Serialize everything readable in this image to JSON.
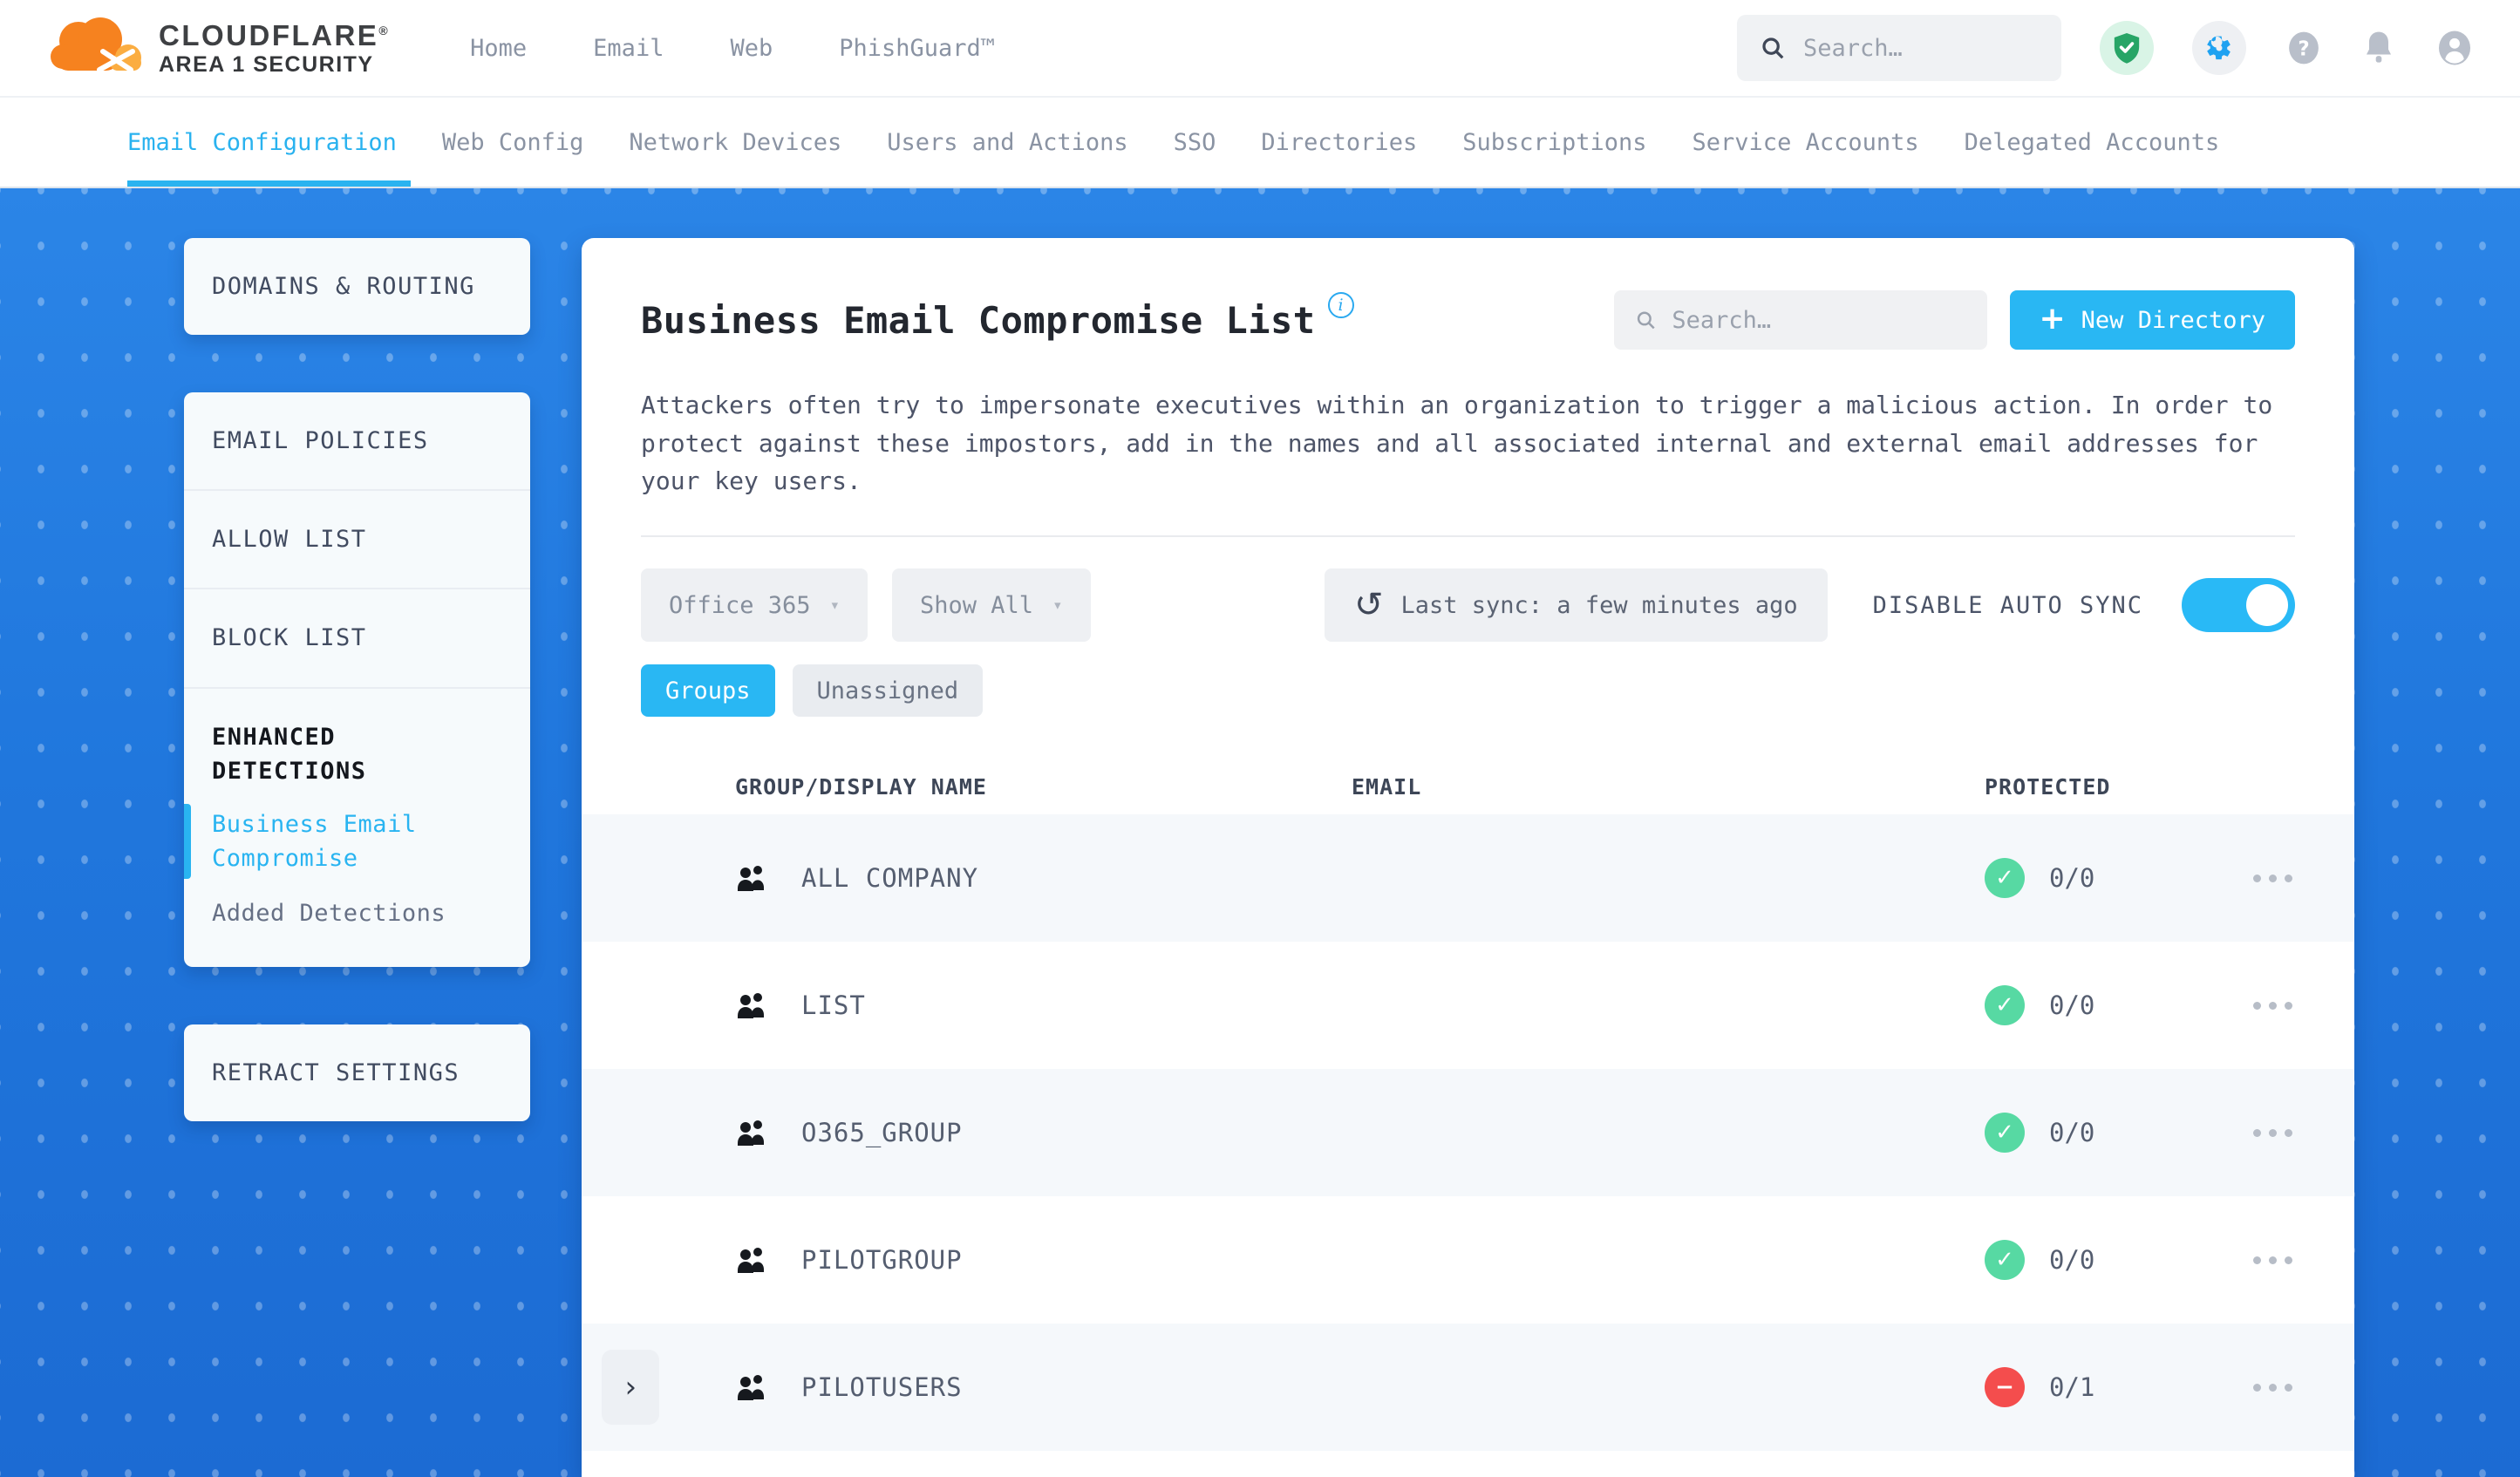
{
  "header": {
    "brand_line1": "CLOUDFLARE",
    "brand_reg": "®",
    "brand_line2": "AREA 1 SECURITY",
    "nav": [
      "Home",
      "Email",
      "Web",
      "PhishGuard™"
    ],
    "search_placeholder": "Search…"
  },
  "subnav": {
    "items": [
      {
        "label": "Email Configuration",
        "active": true
      },
      {
        "label": "Web Config",
        "active": false
      },
      {
        "label": "Network Devices",
        "active": false
      },
      {
        "label": "Users and Actions",
        "active": false
      },
      {
        "label": "SSO",
        "active": false
      },
      {
        "label": "Directories",
        "active": false
      },
      {
        "label": "Subscriptions",
        "active": false
      },
      {
        "label": "Service Accounts",
        "active": false
      },
      {
        "label": "Delegated Accounts",
        "active": false
      }
    ]
  },
  "sidebar": {
    "cards": [
      {
        "items": [
          {
            "label": "DOMAINS & ROUTING"
          }
        ]
      },
      {
        "items": [
          {
            "label": "EMAIL POLICIES",
            "divider": true
          },
          {
            "label": "ALLOW LIST",
            "divider": true
          },
          {
            "label": "BLOCK LIST",
            "divider": true
          },
          {
            "label": "ENHANCED DETECTIONS",
            "emphasis": true
          },
          {
            "label": "Business Email Compromise",
            "sub": true,
            "active": true
          },
          {
            "label": "Added Detections",
            "sub": true,
            "muted": true,
            "last": true
          }
        ]
      },
      {
        "items": [
          {
            "label": "RETRACT SETTINGS"
          }
        ]
      }
    ]
  },
  "main": {
    "title": "Business Email Compromise List",
    "info_glyph": "i",
    "search_placeholder": "Search…",
    "new_directory_plus": "+",
    "new_directory_label": "New Directory",
    "description": "Attackers often try to impersonate executives within an organization to trigger a malicious action. In order to protect against these impostors, add in the names and all associated internal and external email addresses for your key users.",
    "filters": {
      "directory": "Office 365",
      "show": "Show All",
      "caret": "▾"
    },
    "sync": {
      "refresh_glyph": "↺",
      "last_sync_label": "Last sync: a few minutes ago",
      "auto_sync_label": "DISABLE AUTO SYNC",
      "toggle_on": true
    },
    "tabs": [
      {
        "label": "Groups",
        "active": true
      },
      {
        "label": "Unassigned",
        "active": false
      }
    ],
    "table": {
      "columns": [
        "GROUP/DISPLAY NAME",
        "EMAIL",
        "PROTECTED"
      ],
      "rows": [
        {
          "name": "ALL COMPANY",
          "email": "",
          "protected_count": "0/0",
          "status": "protected",
          "expandable": false
        },
        {
          "name": "LIST",
          "email": "",
          "protected_count": "0/0",
          "status": "protected",
          "expandable": false
        },
        {
          "name": "O365_GROUP",
          "email": "",
          "protected_count": "0/0",
          "status": "protected",
          "expandable": false
        },
        {
          "name": "PILOTGROUP",
          "email": "",
          "protected_count": "0/0",
          "status": "protected",
          "expandable": false
        },
        {
          "name": "PILOTUSERS",
          "email": "",
          "protected_count": "0/1",
          "status": "unprotected",
          "expandable": true,
          "expander_glyph": "›"
        }
      ]
    }
  },
  "colors": {
    "accent_cyan": "#29b7f3",
    "background_blue": "#2077dd",
    "protected_green": "#57d9a3",
    "unprotected_red": "#f44d4d",
    "brand_orange": "#f6821f",
    "brand_orange_light": "#fbad41"
  }
}
